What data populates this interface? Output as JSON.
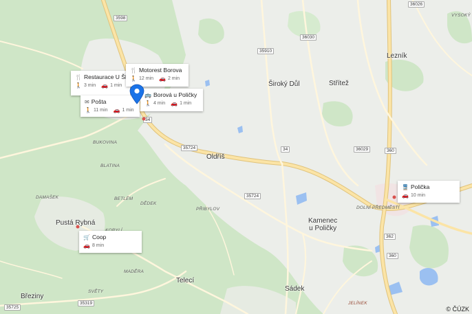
{
  "towns": [
    {
      "name": "Lezník"
    },
    {
      "name": "Široký Důl"
    },
    {
      "name": "Střítež"
    },
    {
      "name": "Oldříš"
    },
    {
      "name": "Kamenec\nu Poličky"
    },
    {
      "name": "Pustá Rybná"
    },
    {
      "name": "Telecí"
    },
    {
      "name": "Sádek"
    },
    {
      "name": "Březiny"
    }
  ],
  "localities": [
    {
      "name": "BUKOVINA"
    },
    {
      "name": "BLATINA"
    },
    {
      "name": "DAMAŠEK"
    },
    {
      "name": "BETLÉM"
    },
    {
      "name": "DĚDEK"
    },
    {
      "name": "PŘIBYLOV"
    },
    {
      "name": "KORYLÍ"
    },
    {
      "name": "MADĚRA"
    },
    {
      "name": "SVĚTY"
    },
    {
      "name": "DOLNÍ PŘEDMĚSTÍ"
    },
    {
      "name": "JELÍNEK"
    },
    {
      "name": "VYSOKÝ LES"
    }
  ],
  "road_shields": [
    "3598",
    "36026",
    "36030",
    "35910",
    "35724",
    "34",
    "36029",
    "360",
    "35724",
    "362",
    "360",
    "35725",
    "35319",
    "34"
  ],
  "cards": [
    {
      "title": "Restaurace U Ško...",
      "icon": "restaurant-icon",
      "walk": "3 min",
      "drive": "1 min"
    },
    {
      "title": "Motorest Borova",
      "icon": "restaurant-icon",
      "walk": "12 min",
      "drive": "2 min"
    },
    {
      "title": "Pošta",
      "icon": "post-office-icon",
      "walk": "11 min",
      "drive": "1 min"
    },
    {
      "title": "Borová u Poličky",
      "icon": "bus-icon",
      "walk": "4 min",
      "drive": "1 min"
    },
    {
      "title": "Polička",
      "icon": "train-icon",
      "drive": "10 min"
    },
    {
      "title": "Coop",
      "icon": "shopping-cart-icon",
      "drive": "8 min"
    }
  ],
  "copyright": "© ČÚZK",
  "colors": {
    "forest": "#cfe6c7",
    "open": "#eceeea",
    "road": "#fbe4a6",
    "road_edge": "#e5c983",
    "water": "#9bc0f1",
    "pin": "#1a73e8"
  }
}
